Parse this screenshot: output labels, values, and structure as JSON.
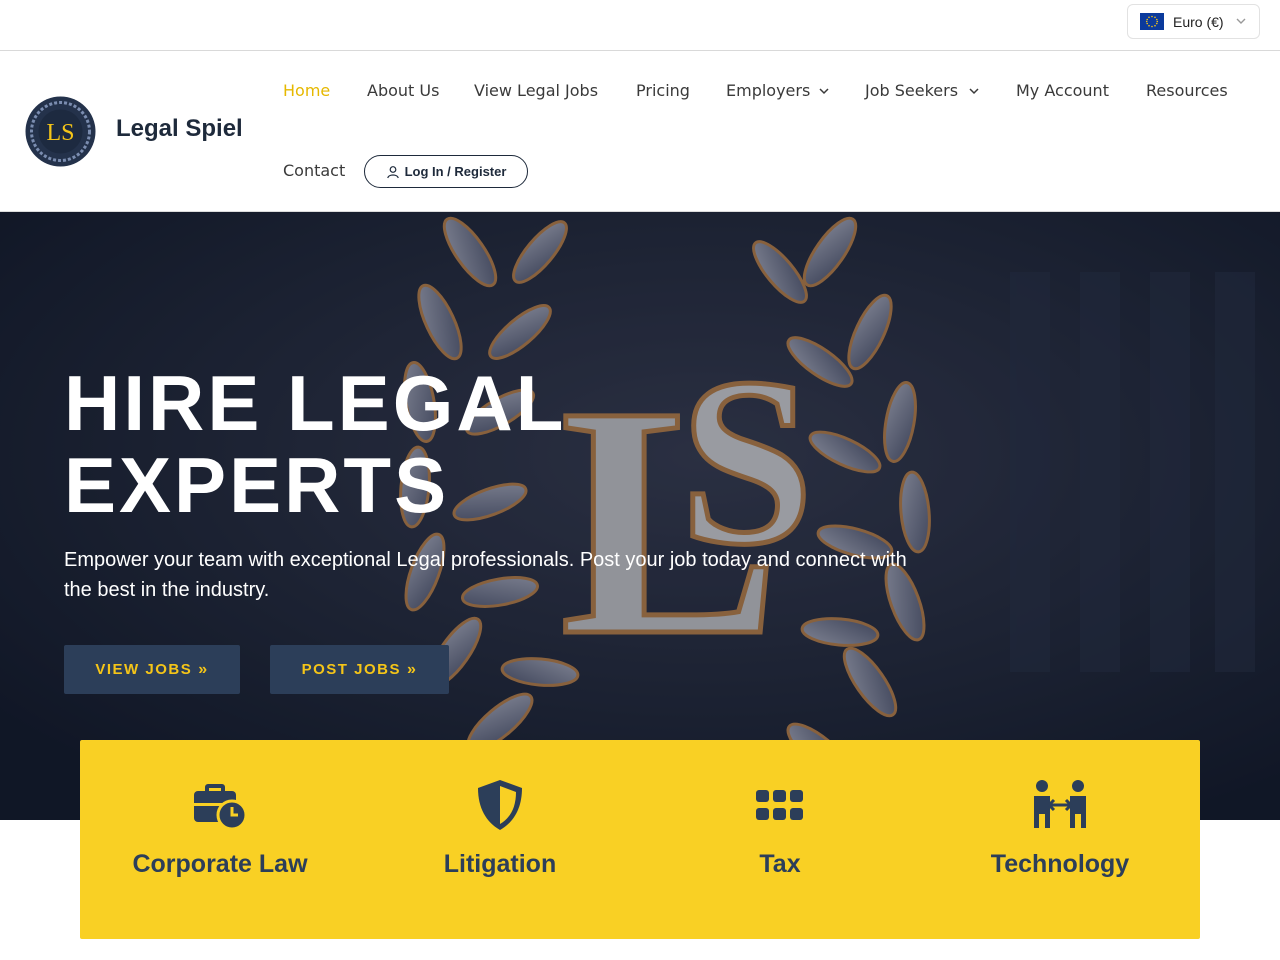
{
  "currency": {
    "label": "Euro (€)",
    "flag_icon": "eu-flag-icon"
  },
  "header": {
    "site_title": "Legal Spiel",
    "logo_letters": "LS",
    "nav": [
      {
        "label": "Home",
        "active": true
      },
      {
        "label": "About Us"
      },
      {
        "label": "View Legal Jobs"
      },
      {
        "label": "Pricing"
      },
      {
        "label": "Employers",
        "has_dropdown": true
      },
      {
        "label": "Job Seekers",
        "has_dropdown": true
      },
      {
        "label": "My Account"
      },
      {
        "label": "Resources"
      },
      {
        "label": "Contact"
      }
    ],
    "login_label": "Log In / Register"
  },
  "hero": {
    "title_line1": "HIRE LEGAL",
    "title_line2": "EXPERTS",
    "subtitle": "Empower your team with exceptional Legal professionals. Post your job today and connect with the best in the industry.",
    "view_jobs_label": "VIEW JOBS",
    "post_jobs_label": "POST JOBS"
  },
  "categories": [
    {
      "label": "Corporate Law",
      "icon": "briefcase-clock-icon"
    },
    {
      "label": "Litigation",
      "icon": "shield-icon"
    },
    {
      "label": "Tax",
      "icon": "grid-icon"
    },
    {
      "label": "Technology",
      "icon": "people-exchange-icon"
    }
  ],
  "colors": {
    "accent": "#f9d024",
    "navy": "#2c3e59",
    "active_nav": "#e6b800"
  }
}
